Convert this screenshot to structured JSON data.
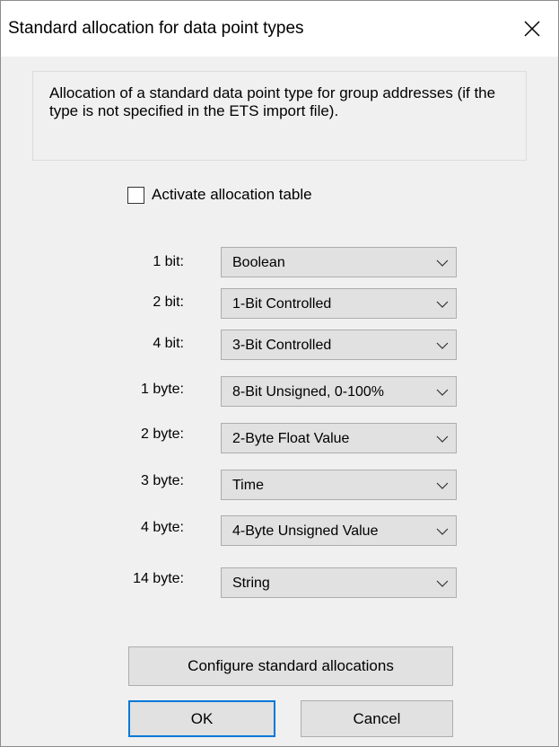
{
  "dialog": {
    "title": "Standard allocation for data point types",
    "close_icon": "close-icon"
  },
  "info": {
    "text": "Allocation of a standard data point type for group addresses (if the type is not specified in the ETS import file)."
  },
  "checkbox": {
    "label": "Activate allocation table",
    "checked": false
  },
  "allocations": [
    {
      "label": "1 bit:",
      "value": "Boolean"
    },
    {
      "label": "2 bit:",
      "value": "1-Bit Controlled"
    },
    {
      "label": "4 bit:",
      "value": "3-Bit Controlled"
    },
    {
      "label": "1 byte:",
      "value": "8-Bit Unsigned, 0-100%"
    },
    {
      "label": "2 byte:",
      "value": "2-Byte Float Value"
    },
    {
      "label": "3 byte:",
      "value": "Time"
    },
    {
      "label": "4 byte:",
      "value": "4-Byte Unsigned Value"
    },
    {
      "label": "14 byte:",
      "value": "String"
    }
  ],
  "buttons": {
    "configure_label": "Configure standard allocations",
    "ok_label": "OK",
    "cancel_label": "Cancel"
  },
  "colors": {
    "accent": "#0078d7",
    "dialog_background": "#f0f0f0",
    "control_background": "#e1e1e1"
  }
}
